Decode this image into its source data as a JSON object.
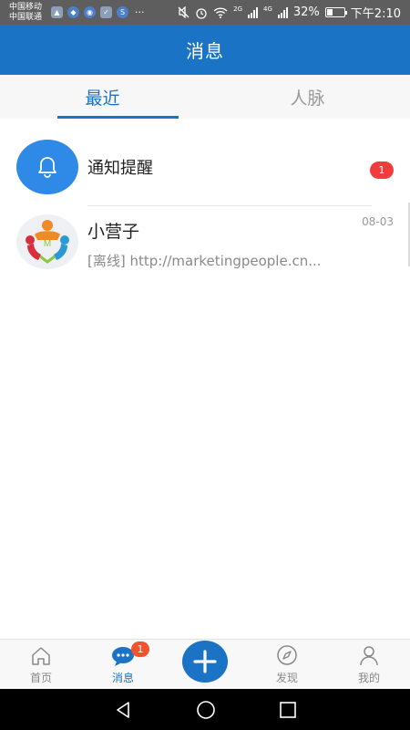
{
  "status_bar": {
    "carrier_line1": "中国移动",
    "carrier_line2": "中国联通",
    "more": "···",
    "net1": "2G",
    "net2": "4G",
    "battery_text": "32%",
    "time": "下午2:10"
  },
  "header": {
    "title": "消息"
  },
  "tabs": [
    {
      "label": "最近",
      "active": true
    },
    {
      "label": "人脉",
      "active": false
    }
  ],
  "conversations": [
    {
      "title": "通知提醒",
      "badge": "1",
      "icon": "bell-icon"
    },
    {
      "name": "小营子",
      "time": "08-03",
      "preview": "[离线] http://marketingpeople.cn...",
      "avatar": "marketingpeople-logo",
      "avatar_letter": "M"
    }
  ],
  "bottom_nav": [
    {
      "label": "首页",
      "icon": "home-icon"
    },
    {
      "label": "消息",
      "icon": "chat-icon",
      "badge": "1",
      "active": true
    },
    {
      "label": "发现",
      "icon": "compass-icon"
    },
    {
      "label": "我的",
      "icon": "user-icon"
    }
  ],
  "colors": {
    "brand": "#1a73c4",
    "badge": "#f03c3c",
    "status_bar": "#5e5e5e"
  },
  "battery_level": 0.32
}
